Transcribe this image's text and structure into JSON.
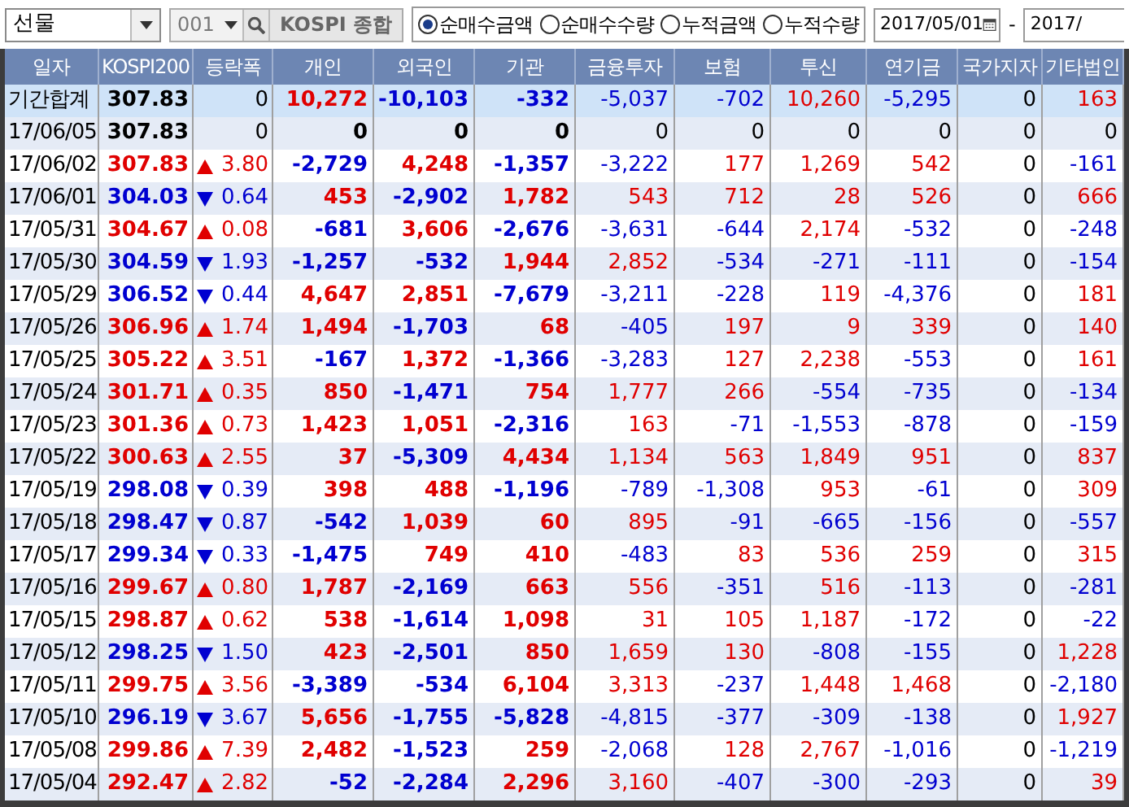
{
  "toolbar": {
    "market_select": {
      "value": "선물"
    },
    "code_field": {
      "value": "001"
    },
    "index_name": "KOSPI 종합",
    "radios": [
      {
        "label": "순매수금액",
        "selected": true
      },
      {
        "label": "순매수수량",
        "selected": false
      },
      {
        "label": "누적금액",
        "selected": false
      },
      {
        "label": "누적수량",
        "selected": false
      }
    ],
    "date_from": "2017/05/01",
    "separator": "-",
    "date_to": "2017/"
  },
  "table": {
    "columns": [
      "일자",
      "KOSPI200",
      "등락폭",
      "개인",
      "외국인",
      "기관",
      "금융투자",
      "보험",
      "투신",
      "연기금",
      "국가지자",
      "기타법인"
    ],
    "rows": [
      {
        "kind": "summary",
        "date": "기간합계",
        "kospi200": "307.83",
        "up": false,
        "down": false,
        "change_value": "0",
        "values": [
          "10,272",
          "-10,103",
          "-332",
          "-5,037",
          "-702",
          "10,260",
          "-5,295",
          "0",
          "163"
        ]
      },
      {
        "kind": "day",
        "date": "17/06/05",
        "kospi200": "307.83",
        "up": false,
        "down": false,
        "change_value": "0",
        "values": [
          "0",
          "0",
          "0",
          "0",
          "0",
          "0",
          "0",
          "0",
          "0"
        ]
      },
      {
        "kind": "day",
        "date": "17/06/02",
        "kospi200": "307.83",
        "up": true,
        "down": false,
        "change_value": "3.80",
        "values": [
          "-2,729",
          "4,248",
          "-1,357",
          "-3,222",
          "177",
          "1,269",
          "542",
          "0",
          "-161"
        ]
      },
      {
        "kind": "day",
        "date": "17/06/01",
        "kospi200": "304.03",
        "up": false,
        "down": true,
        "change_value": "0.64",
        "values": [
          "453",
          "-2,902",
          "1,782",
          "543",
          "712",
          "28",
          "526",
          "0",
          "666"
        ]
      },
      {
        "kind": "day",
        "date": "17/05/31",
        "kospi200": "304.67",
        "up": true,
        "down": false,
        "change_value": "0.08",
        "values": [
          "-681",
          "3,606",
          "-2,676",
          "-3,631",
          "-644",
          "2,174",
          "-532",
          "0",
          "-248"
        ]
      },
      {
        "kind": "day",
        "date": "17/05/30",
        "kospi200": "304.59",
        "up": false,
        "down": true,
        "change_value": "1.93",
        "values": [
          "-1,257",
          "-532",
          "1,944",
          "2,852",
          "-534",
          "-271",
          "-111",
          "0",
          "-154"
        ]
      },
      {
        "kind": "day",
        "date": "17/05/29",
        "kospi200": "306.52",
        "up": false,
        "down": true,
        "change_value": "0.44",
        "values": [
          "4,647",
          "2,851",
          "-7,679",
          "-3,211",
          "-228",
          "119",
          "-4,376",
          "0",
          "181"
        ]
      },
      {
        "kind": "day",
        "date": "17/05/26",
        "kospi200": "306.96",
        "up": true,
        "down": false,
        "change_value": "1.74",
        "values": [
          "1,494",
          "-1,703",
          "68",
          "-405",
          "197",
          "9",
          "339",
          "0",
          "140"
        ]
      },
      {
        "kind": "day",
        "date": "17/05/25",
        "kospi200": "305.22",
        "up": true,
        "down": false,
        "change_value": "3.51",
        "values": [
          "-167",
          "1,372",
          "-1,366",
          "-3,283",
          "127",
          "2,238",
          "-553",
          "0",
          "161"
        ]
      },
      {
        "kind": "day",
        "date": "17/05/24",
        "kospi200": "301.71",
        "up": true,
        "down": false,
        "change_value": "0.35",
        "values": [
          "850",
          "-1,471",
          "754",
          "1,777",
          "266",
          "-554",
          "-735",
          "0",
          "-134"
        ]
      },
      {
        "kind": "day",
        "date": "17/05/23",
        "kospi200": "301.36",
        "up": true,
        "down": false,
        "change_value": "0.73",
        "values": [
          "1,423",
          "1,051",
          "-2,316",
          "163",
          "-71",
          "-1,553",
          "-878",
          "0",
          "-159"
        ]
      },
      {
        "kind": "day",
        "date": "17/05/22",
        "kospi200": "300.63",
        "up": true,
        "down": false,
        "change_value": "2.55",
        "values": [
          "37",
          "-5,309",
          "4,434",
          "1,134",
          "563",
          "1,849",
          "951",
          "0",
          "837"
        ]
      },
      {
        "kind": "day",
        "date": "17/05/19",
        "kospi200": "298.08",
        "up": false,
        "down": true,
        "change_value": "0.39",
        "values": [
          "398",
          "488",
          "-1,196",
          "-789",
          "-1,308",
          "953",
          "-61",
          "0",
          "309"
        ]
      },
      {
        "kind": "day",
        "date": "17/05/18",
        "kospi200": "298.47",
        "up": false,
        "down": true,
        "change_value": "0.87",
        "values": [
          "-542",
          "1,039",
          "60",
          "895",
          "-91",
          "-665",
          "-156",
          "0",
          "-557"
        ]
      },
      {
        "kind": "day",
        "date": "17/05/17",
        "kospi200": "299.34",
        "up": false,
        "down": true,
        "change_value": "0.33",
        "values": [
          "-1,475",
          "749",
          "410",
          "-483",
          "83",
          "536",
          "259",
          "0",
          "315"
        ]
      },
      {
        "kind": "day",
        "date": "17/05/16",
        "kospi200": "299.67",
        "up": true,
        "down": false,
        "change_value": "0.80",
        "values": [
          "1,787",
          "-2,169",
          "663",
          "556",
          "-351",
          "516",
          "-113",
          "0",
          "-281"
        ]
      },
      {
        "kind": "day",
        "date": "17/05/15",
        "kospi200": "298.87",
        "up": true,
        "down": false,
        "change_value": "0.62",
        "values": [
          "538",
          "-1,614",
          "1,098",
          "31",
          "105",
          "1,187",
          "-172",
          "0",
          "-22"
        ]
      },
      {
        "kind": "day",
        "date": "17/05/12",
        "kospi200": "298.25",
        "up": false,
        "down": true,
        "change_value": "1.50",
        "values": [
          "423",
          "-2,501",
          "850",
          "1,659",
          "130",
          "-808",
          "-155",
          "0",
          "1,228"
        ]
      },
      {
        "kind": "day",
        "date": "17/05/11",
        "kospi200": "299.75",
        "up": true,
        "down": false,
        "change_value": "3.56",
        "values": [
          "-3,389",
          "-534",
          "6,104",
          "3,313",
          "-237",
          "1,448",
          "1,468",
          "0",
          "-2,180"
        ]
      },
      {
        "kind": "day",
        "date": "17/05/10",
        "kospi200": "296.19",
        "up": false,
        "down": true,
        "change_value": "3.67",
        "values": [
          "5,656",
          "-1,755",
          "-5,828",
          "-4,815",
          "-377",
          "-309",
          "-138",
          "0",
          "1,927"
        ]
      },
      {
        "kind": "day",
        "date": "17/05/08",
        "kospi200": "299.86",
        "up": true,
        "down": false,
        "change_value": "7.39",
        "values": [
          "2,482",
          "-1,523",
          "259",
          "-2,068",
          "128",
          "2,767",
          "-1,016",
          "0",
          "-1,219"
        ]
      },
      {
        "kind": "day",
        "date": "17/05/04",
        "kospi200": "292.47",
        "up": true,
        "down": false,
        "change_value": "2.82",
        "values": [
          "-52",
          "-2,284",
          "2,296",
          "3,160",
          "-407",
          "-300",
          "-293",
          "0",
          "39"
        ]
      }
    ]
  }
}
